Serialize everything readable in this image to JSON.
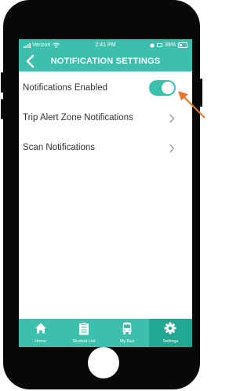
{
  "status_bar": {
    "carrier": "Verizon",
    "time": "2:41 PM",
    "battery": "39%"
  },
  "header": {
    "title": "NOTIFICATION SETTINGS",
    "back_icon": "chevron-left-icon"
  },
  "settings": {
    "notifications_enabled": {
      "label": "Notifications Enabled",
      "on": true
    },
    "trip_alert_zone": {
      "label": "Trip Alert Zone Notifications",
      "icon": "chevron-right-icon"
    },
    "scan_notifications": {
      "label": "Scan Notifications",
      "icon": "chevron-right-icon"
    }
  },
  "tabs": [
    {
      "label": "Home",
      "icon": "home-icon",
      "active": false
    },
    {
      "label": "Student List",
      "icon": "clipboard-icon",
      "active": false
    },
    {
      "label": "My Bus",
      "icon": "bus-icon",
      "active": false
    },
    {
      "label": "Settings",
      "icon": "gear-icon",
      "active": true
    }
  ],
  "colors": {
    "teal": "#3cc0ad",
    "teal_active": "#22a793",
    "annotation_arrow": "#e8772e",
    "phone_body": "#080808"
  }
}
